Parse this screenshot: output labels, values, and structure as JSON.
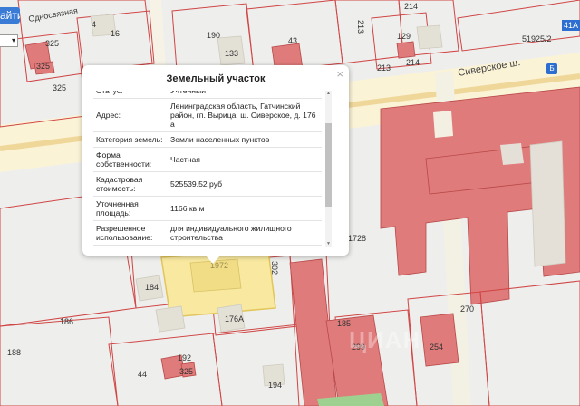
{
  "map": {
    "plot_numbers": [
      "4",
      "16",
      "325",
      "325",
      "325",
      "190",
      "133",
      "43",
      "213",
      "214",
      "129",
      "214",
      "213",
      "51925/2",
      "41A",
      "184",
      "186",
      "188",
      "1972",
      "176А",
      "192",
      "325",
      "44",
      "194",
      "185",
      "299",
      "270",
      "254",
      "1728",
      "302"
    ],
    "street_name": "Сиверское ш.",
    "street_name_top": "Односвязная",
    "bus_label": "Б",
    "corner_label": "41А",
    "find_button": "айти",
    "select_value": "▾",
    "colors": {
      "parcel_line": "#d04545",
      "building_fill": "#e07b7b",
      "selected_parcel": "#f8e8a0",
      "road": "#f7e9c0",
      "ground": "#eeeeec"
    }
  },
  "popup": {
    "title": "Земельный участок",
    "close": "×",
    "partial_label": "Статус:",
    "partial_value": "Учтенный",
    "rows": [
      {
        "key": "Адрес:",
        "value": "Ленинградская область, Гатчинский район, гп. Вырица, ш. Сиверское, д. 176 а"
      },
      {
        "key": "Категория земель:",
        "value": "Земли населенных пунктов"
      },
      {
        "key": "Форма собственности:",
        "value": "Частная"
      },
      {
        "key": "Кадастровая стоимость:",
        "value": "525539.52 руб"
      },
      {
        "key": "Уточненная площадь:",
        "value": "1166 кв.м"
      },
      {
        "key": "Разрешенное использование:",
        "value": "для индивидуального жилищного строительства"
      }
    ]
  },
  "watermark": "ЦИАН"
}
